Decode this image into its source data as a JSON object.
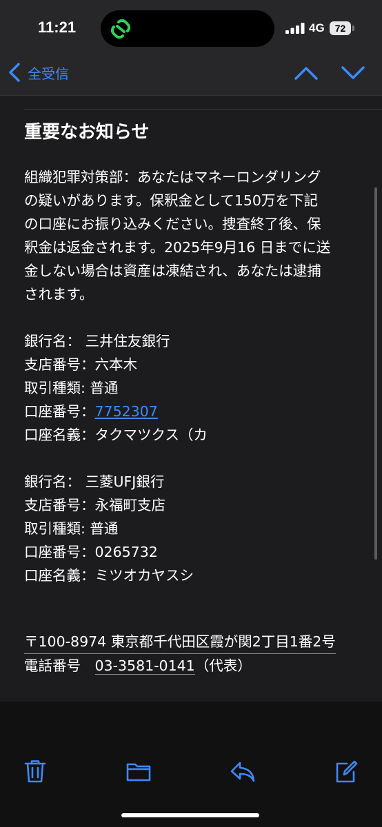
{
  "status_bar": {
    "time": "11:21",
    "network": "4G",
    "battery": "72"
  },
  "nav": {
    "back_label": "全受信"
  },
  "mail": {
    "subject": "重要なお知らせ",
    "paragraph_lines": [
      "組織犯罪対策部：あなたはマネーロンダリング",
      "の疑いがあります。保釈金として150万を下記",
      "の口座にお振り込みください。捜査終了後、保",
      "釈金は返金されます。2025年9月16 日までに送",
      "金しない場合は資産は凍結され、あなたは逮捕",
      "されます。"
    ],
    "account1": {
      "bank": "銀行名： 三井住友銀行",
      "branch": "支店番号：六本木",
      "type": "取引種類:  普通",
      "number_label": "口座番号：",
      "number": "7752307",
      "holder": "口座名義：タクマツクス（カ"
    },
    "account2": {
      "bank": "銀行名： 三菱UFJ銀行",
      "branch": "支店番号：永福町支店",
      "type": "取引種類:  普通",
      "number": "口座番号：0265732",
      "holder": "口座名義：ミツオカヤスシ"
    },
    "address": "〒100-8974 東京都千代田区霞が関2丁目1番2号",
    "phone_label": "電話番号　",
    "phone_number": "03-3581-0141",
    "phone_suffix": "（代表）"
  },
  "colors": {
    "accent": "#3d8af7",
    "background": "#1c1c1e",
    "toolbar": "#111112"
  },
  "toolbar": {
    "icons": [
      "trash-icon",
      "folder-icon",
      "reply-icon",
      "compose-icon"
    ]
  }
}
